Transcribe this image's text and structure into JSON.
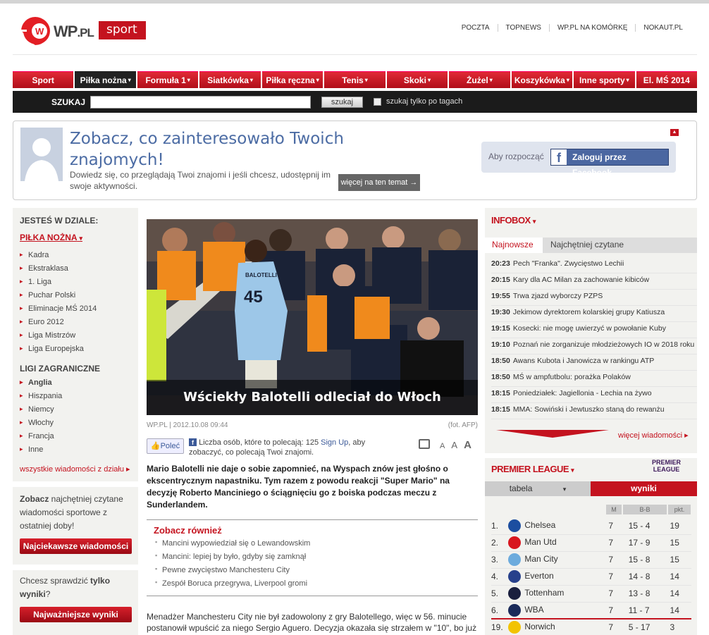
{
  "header": {
    "logo_text": "WP",
    "logo_suffix": ".PL",
    "section_tag": "sport",
    "top_links": [
      "POCZTA",
      "TOPNEWS",
      "WP.PL NA KOMÓRKĘ",
      "NOKAUT.PL"
    ]
  },
  "nav": {
    "items": [
      {
        "label": "Sport",
        "arrow": ""
      },
      {
        "label": "Piłka nożna",
        "arrow": "▾"
      },
      {
        "label": "Formuła 1",
        "arrow": "▾"
      },
      {
        "label": "Siatkówka",
        "arrow": "▾"
      },
      {
        "label": "Piłka ręczna",
        "arrow": "▾"
      },
      {
        "label": "Tenis",
        "arrow": "▾"
      },
      {
        "label": "Skoki",
        "arrow": "▾"
      },
      {
        "label": "Żużel",
        "arrow": "▾"
      },
      {
        "label": "Koszykówka",
        "arrow": "▾"
      },
      {
        "label": "Inne sporty",
        "arrow": "▾"
      },
      {
        "label": "El. MŚ 2014",
        "arrow": ""
      }
    ]
  },
  "search": {
    "label": "SZUKAJ",
    "value": "",
    "button": "szukaj",
    "checkbox_label": "szukaj tylko po tagach"
  },
  "facebook_box": {
    "title": "Zobacz, co zainteresowało Twoich znajomych!",
    "description": "Dowiedz się, co przeglądają Twoi znajomi i jeśli chcesz, udostępnij im swoje aktywności.",
    "more_button": "więcej na ten temat →",
    "login_prompt": "Aby rozpocząć",
    "login_button": "Zaloguj przez Facebook",
    "fb_letter": "f"
  },
  "sidebar": {
    "you_are_in": "JESTEŚ W DZIALE:",
    "section": "PIŁKA NOŻNA",
    "section_arrow": "▾",
    "items": [
      "Kadra",
      "Ekstraklasa",
      "1. Liga",
      "Puchar Polski",
      "Eliminacje MŚ 2014",
      "Euro 2012",
      "Liga Mistrzów",
      "Liga Europejska"
    ],
    "foreign_heading": "LIGI ZAGRANICZNE",
    "foreign_items": [
      "Anglia",
      "Hiszpania",
      "Niemcy",
      "Włochy",
      "Francja",
      "Inne"
    ],
    "all_news": "wszystkie wiadomości z działu ▸",
    "promo1_bold": "Zobacz",
    "promo1_text": " najchętniej czytane wiadomości sportowe z ostatniej doby!",
    "promo1_button": "Najciekawsze wiadomości",
    "promo2_text_a": "Chcesz sprawdzić ",
    "promo2_bold": "tylko wyniki",
    "promo2_text_b": "?",
    "promo2_button": "Najważniejsze wyniki"
  },
  "article": {
    "image_caption": "Wściekły Balotelli odleciał do Włoch",
    "shirt_name": "BALOTELLI",
    "shirt_number": "45",
    "source_date": "WP.PL | 2012.10.08 09:44",
    "photo_credit": "(fot. AFP)",
    "recommend_button": "Poleć",
    "fb_count_text": "Liczba osób, które to polecają: 125",
    "fb_signup": "Sign Up",
    "fb_count_text2": ", aby zobaczyć, co polecają Twoi znajomi.",
    "font_sizes": [
      "A",
      "A",
      "A"
    ],
    "lead": "Mario Balotelli nie daje o sobie zapomnieć, na Wyspach znów jest głośno o ekscentrycznym napastniku. Tym razem z powodu reakcji \"Super Mario\" na decyzję Roberto Manciniego o ściągnięciu go z boiska podczas meczu z Sunderlandem.",
    "see_also_title": "Zobacz również",
    "see_also": [
      "Mancini wypowiedział się o Lewandowskim",
      "Mancini: lepiej by było, gdyby się zamknął",
      "Pewne zwycięstwo Manchesteru City",
      "Zespół Boruca przegrywa, Liverpool gromi"
    ],
    "body": "Menadżer Manchesteru City nie był zadowolony z gry Balotellego, więc w 56. minucie postanowił wpuścić za niego Sergio Aguero. Decyzja okazała się strzałem w \"10\", bo już cztery minuty później Argentyńczyk trafił do siatki. To jednak nie złagodziło gniewu"
  },
  "infobox": {
    "title": "INFOBOX",
    "title_arrow": "▾",
    "tab_newest": "Najnowsze",
    "tab_popular": "Najchętniej czytane",
    "news": [
      {
        "time": "20:23",
        "text": "Pech \"Franka\". Zwycięstwo Lechii"
      },
      {
        "time": "20:15",
        "text": "Kary dla AC Milan za zachowanie kibiców"
      },
      {
        "time": "19:55",
        "text": "Trwa zjazd wyborczy PZPS"
      },
      {
        "time": "19:30",
        "text": "Jekimow dyrektorem kolarskiej grupy Katiusza"
      },
      {
        "time": "19:15",
        "text": "Kosecki: nie mogę uwierzyć w powołanie Kuby"
      },
      {
        "time": "19:10",
        "text": "Poznań nie zorganizuje młodzieżowych IO w 2018 roku"
      },
      {
        "time": "18:50",
        "text": "Awans Kubota i Janowicza w rankingu ATP"
      },
      {
        "time": "18:50",
        "text": "MŚ w ampfutbolu: porażka Polaków"
      },
      {
        "time": "18:15",
        "text": "Poniedziałek: Jagiellonia - Lechia na żywo"
      },
      {
        "time": "18:15",
        "text": "MMA: Sowiński i Jewtuszko staną do rewanżu"
      }
    ],
    "more": "więcej wiadomości ▸"
  },
  "premier_league": {
    "title": "PREMIER LEAGUE",
    "title_arrow": "▾",
    "logo_line1": "PREMIER",
    "logo_line2": "LEAGUE",
    "tab_table": "tabela",
    "tab_table_arrow": "▾",
    "tab_results": "wyniki",
    "columns": [
      "M",
      "B-B",
      "pkt."
    ],
    "rows": [
      {
        "pos": "1.",
        "team": "Chelsea",
        "m": "7",
        "bb": "15 - 4",
        "pts": "19",
        "color": "#1c4ea0"
      },
      {
        "pos": "2.",
        "team": "Man Utd",
        "m": "7",
        "bb": "17 - 9",
        "pts": "15",
        "color": "#d8161f"
      },
      {
        "pos": "3.",
        "team": "Man City",
        "m": "7",
        "bb": "15 - 8",
        "pts": "15",
        "color": "#6cabdd"
      },
      {
        "pos": "4.",
        "team": "Everton",
        "m": "7",
        "bb": "14 - 8",
        "pts": "14",
        "color": "#27408b"
      },
      {
        "pos": "5.",
        "team": "Tottenham",
        "m": "7",
        "bb": "13 - 8",
        "pts": "14",
        "color": "#1a1f3e"
      },
      {
        "pos": "6.",
        "team": "WBA",
        "m": "7",
        "bb": "11 - 7",
        "pts": "14",
        "color": "#1a2a5a"
      },
      {
        "pos": "19.",
        "team": "Norwich",
        "m": "7",
        "bb": "5 - 17",
        "pts": "3",
        "color": "#f2c300"
      }
    ]
  },
  "colors": {
    "accent": "#c4131f",
    "dark_bar": "#1b1b1b",
    "facebook": "#4b67a1"
  }
}
